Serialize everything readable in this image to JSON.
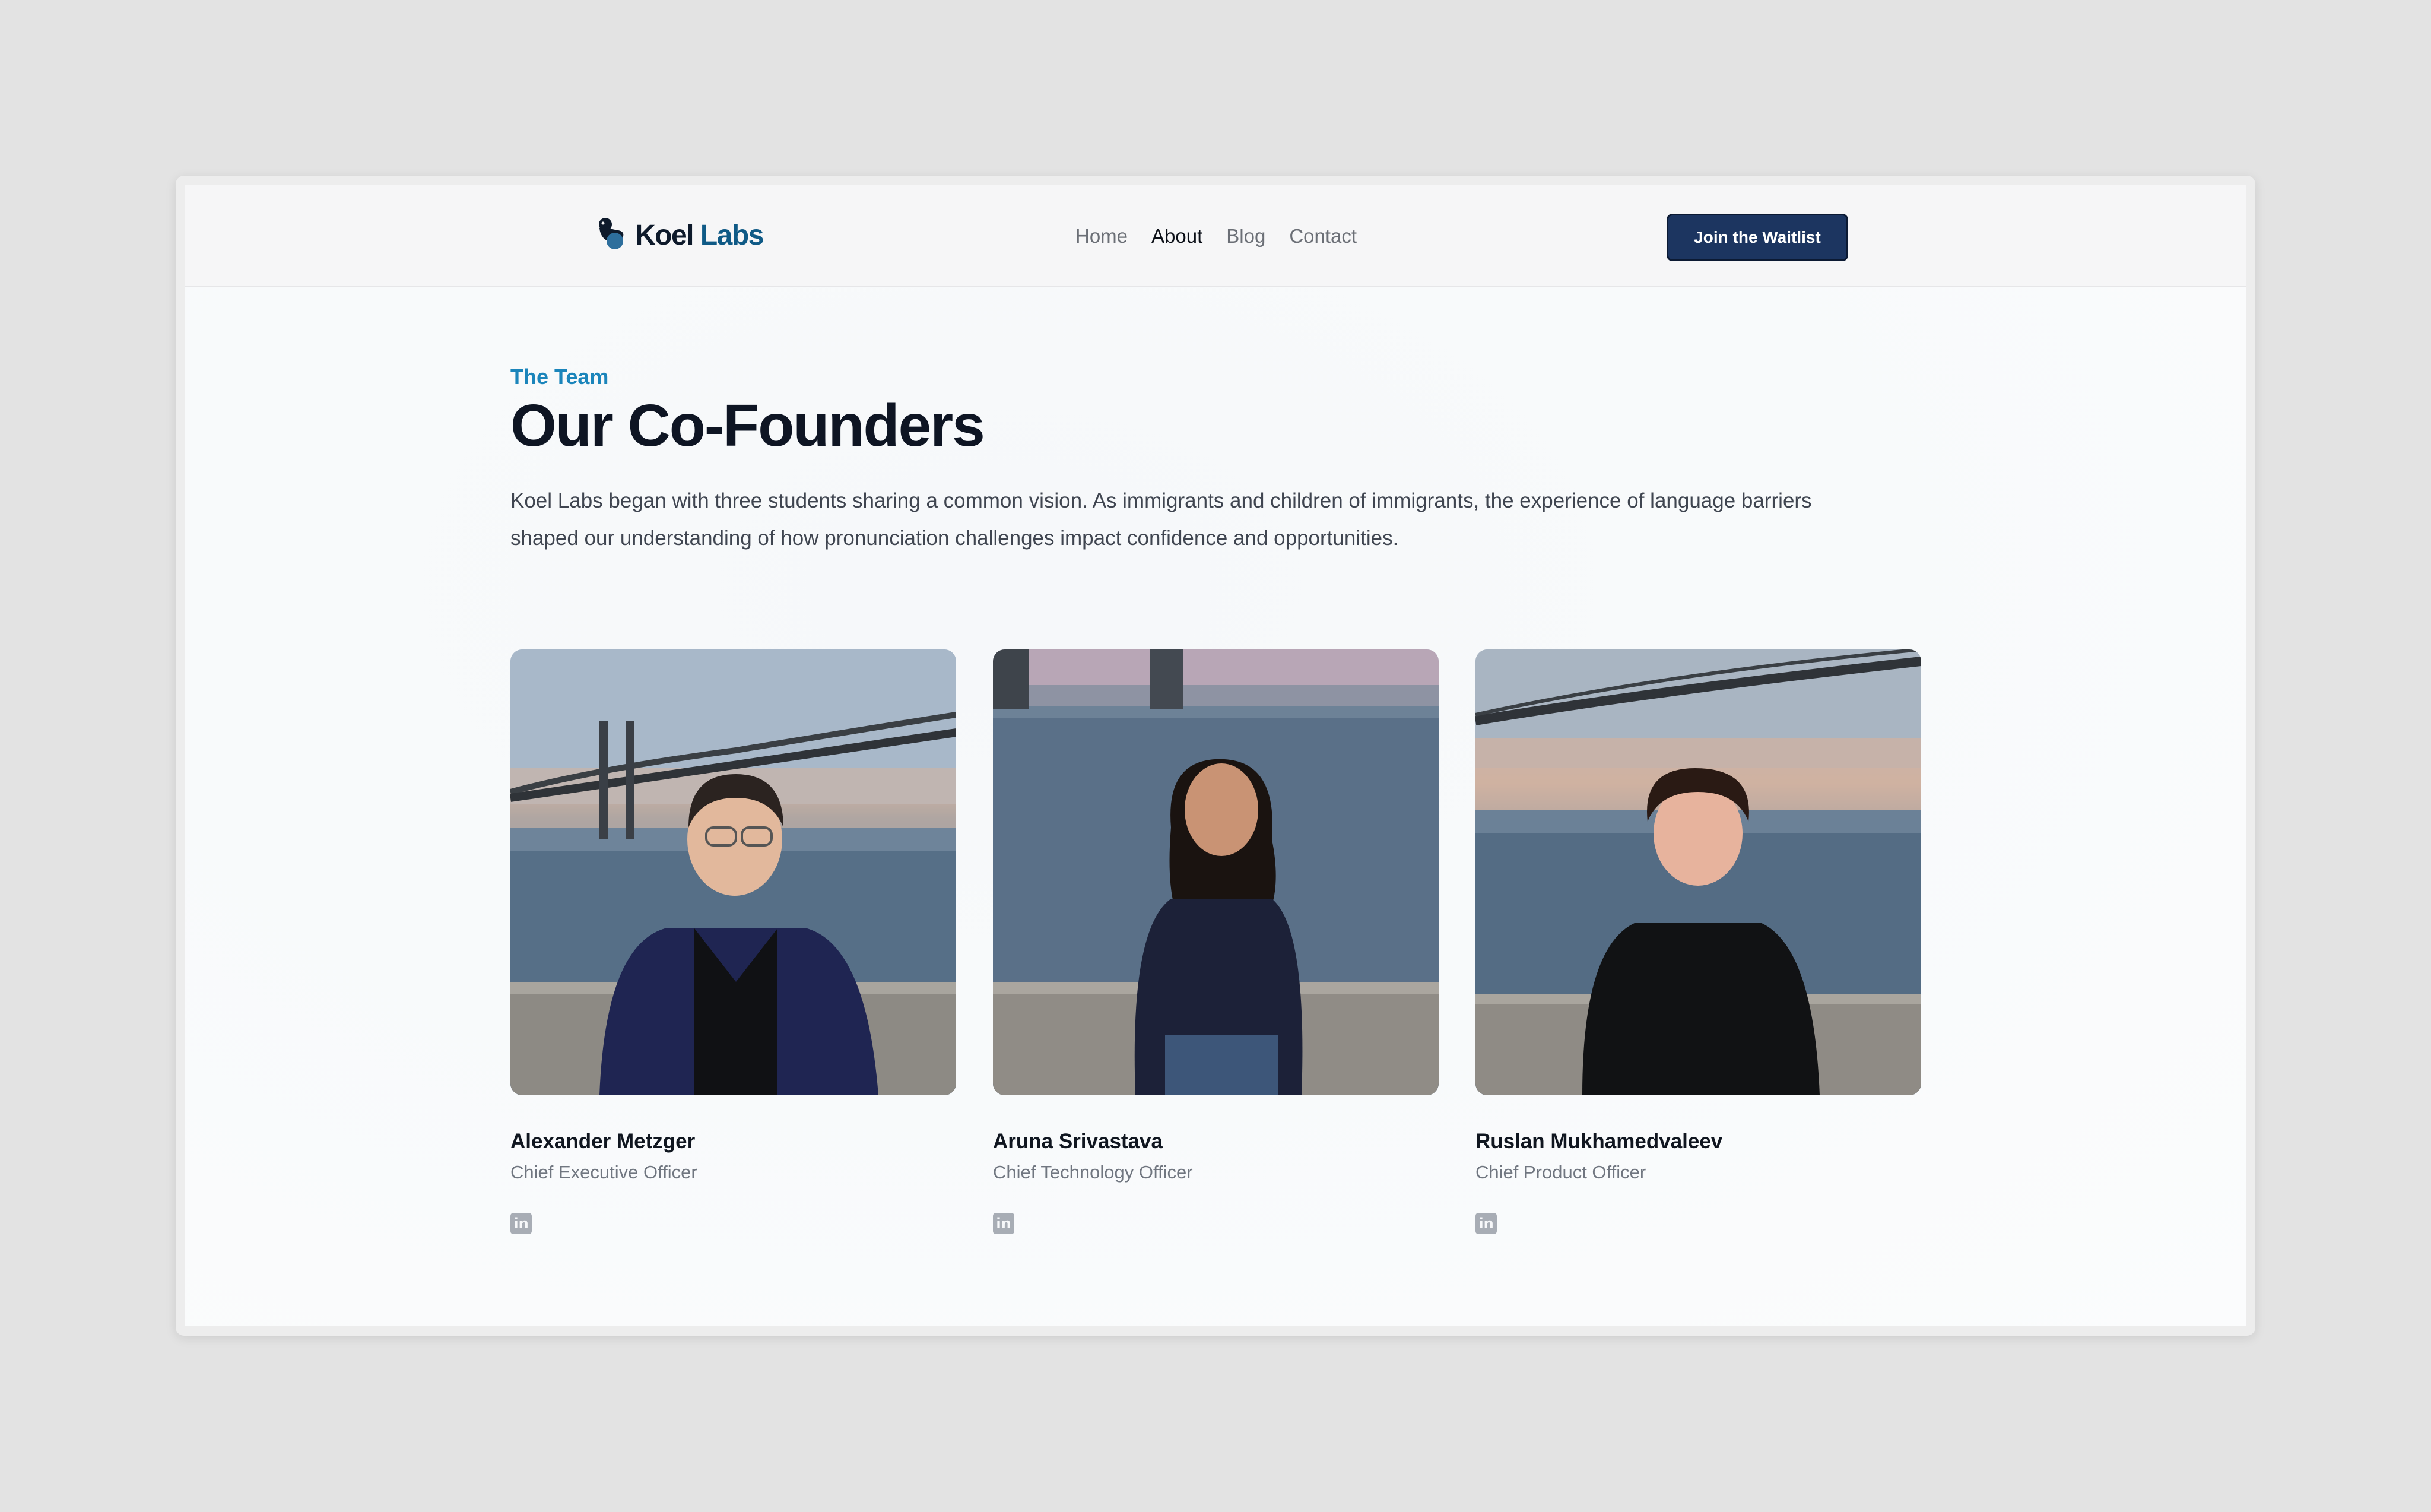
{
  "nav": {
    "logo_primary": "Koel",
    "logo_secondary": "Labs",
    "links": [
      {
        "label": "Home",
        "active": false
      },
      {
        "label": "About",
        "active": true
      },
      {
        "label": "Blog",
        "active": false
      },
      {
        "label": "Contact",
        "active": false
      }
    ],
    "cta_label": "Join the Waitlist"
  },
  "hero": {
    "eyebrow": "The Team",
    "title": "Our Co-Founders",
    "description": "Koel Labs began with three students sharing a common vision. As immigrants and children of immigrants, the experience of language barriers shaped our understanding of how pronunciation challenges impact confidence and opportunities."
  },
  "founders": [
    {
      "name": "Alexander Metzger",
      "role": "Chief Executive Officer",
      "social_icon": "linkedin-icon"
    },
    {
      "name": "Aruna Srivastava",
      "role": "Chief Technology Officer",
      "social_icon": "linkedin-icon"
    },
    {
      "name": "Ruslan Mukhamedvaleev",
      "role": "Chief Product Officer",
      "social_icon": "linkedin-icon"
    }
  ],
  "colors": {
    "accent": "#1b85bb",
    "cta_bg": "#1c3560",
    "logo_labs": "#0f5a86"
  }
}
